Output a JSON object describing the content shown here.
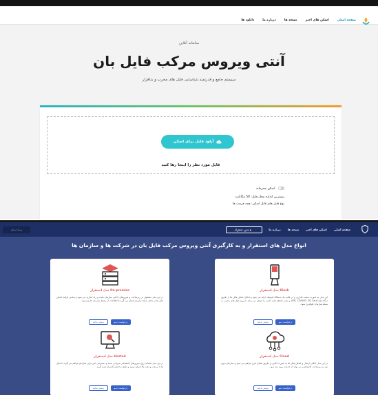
{
  "nav": {
    "items": [
      "صفحه اصلی",
      "اسکن های اخیر",
      "نسخه ها",
      "درباره ما",
      "دانلود ها"
    ]
  },
  "hero": {
    "eyebrow": "سامانه آنلاین",
    "title": "آنتی ویروس مرکب فایل بان",
    "subtitle": "سیستم جامع و قدرتمند شناسایی فایل های مخرب و بدافزار"
  },
  "upload": {
    "button_label": "آپلود فایل برای اسکن",
    "drop_hint": "فایل مورد نظر را اینجا رها کنید",
    "private_scan_label": "اسکن محرمانه",
    "max_size_label": "بیشترین اندازه مجاز فایل: 50 مگابایت",
    "allowed_types_label": "نوع فایل های قابل اسکن: همه فرمت ها"
  },
  "bottom_nav": {
    "items": [
      "صفحه اصلی",
      "اسکن های اخیر",
      "نسخه ها",
      "درباره ما"
    ],
    "download_label": "دانلود کاتالوگ",
    "corner_label": "مرکز اسکن"
  },
  "section": {
    "title": "انواع مدل های استقرار و به کارگیری آنتی ویروس مرکب فایل بان در شرکت ها و سازمان ها"
  },
  "models": [
    {
      "title": "مدل استقرار Kiosk",
      "description": "این مدل به صورت سخت افزاری و در قالب یک دستگاه کیوسک ارائه می شود و امکان اسکن فایل ها از طریق درگاه های USB، CD/DVD، SD Card و سایر حافظه های جانبی را فراهم می نماید تا ورود فایل های مخرب به شبکه سازمان جلوگیری شود.",
      "primary_btn": "درخواست دمو",
      "secondary_btn": "بیشتر بدانید"
    },
    {
      "title": "مدل استقرار On-premise",
      "description": "در این مدل محصول در زیرساخت و سرورهای داخلی سازمان نصب و راه اندازی می شود و تمامی فرآیند اسکن فایل ها در داخل شبکه سازمان انجام می گیرد تا اطلاعات از محیط سازمان خارج نشود.",
      "primary_btn": "درخواست دمو",
      "secondary_btn": "بیشتر بدانید"
    },
    {
      "title": "مدل استقرار Cloud",
      "description": "در این مدل امکان ارسال و اسکن فایل ها به صورت آنلاین از طریق فضای ابری فراهم می شود و سازمان بدون نیاز به زیرساخت اختصاصی می تواند از خدمات بهره مند شود.",
      "primary_btn": "درخواست دمو",
      "secondary_btn": "بیشتر بدانید"
    },
    {
      "title": "مدل استقرار Hosted",
      "description": "در این مدل سامانه روی سرورهای اختصاصی میزبانی شده و دسترسی امن برای سازمان فراهم می گردد تا فایل ها با سرعت و دقت بالا اسکن شوند و نتایج در اختیار کاربران قرار گیرد.",
      "primary_btn": "درخواست دمو",
      "secondary_btn": "بیشتر بدانید"
    }
  ],
  "colors": {
    "accent": "#2fc6cf",
    "nav_active": "#0d8fb3",
    "model_title": "#e25555",
    "bottom_bg": "#3a4c86",
    "button_blue": "#3762c9"
  }
}
